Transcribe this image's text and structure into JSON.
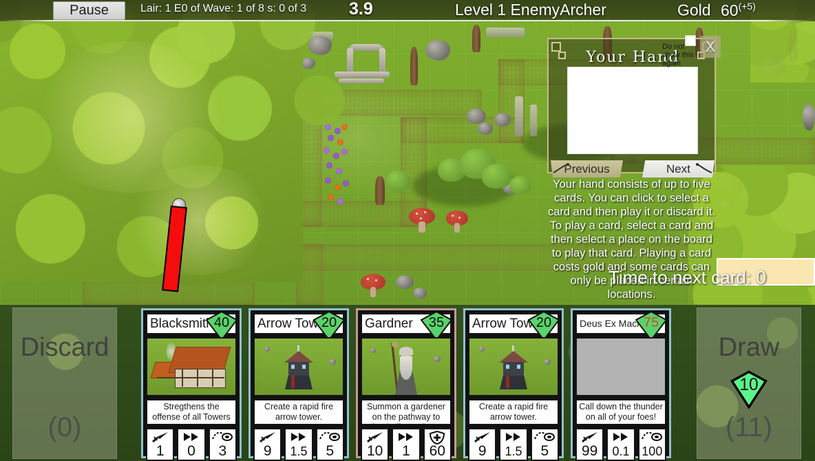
{
  "topbar": {
    "pause_label": "Pause",
    "wave_info": "Lair: 1 E0 of Wave: 1 of 8 s: 0 of 3",
    "timer": "3.9",
    "level_name": "Level 1 EnemyArcher",
    "gold_label": "Gold",
    "gold_value": "60",
    "gold_delta": "(+5)"
  },
  "dialog": {
    "title": "Your Hand",
    "do_not_show_label": "Do not show this again",
    "close_label": "X",
    "previous_label": "Previous",
    "next_label": "Next",
    "body": "Your hand consists of up to five cards. You can click to select a card and then play it or discard it. To play a card, select a card and then select a place on the board to play that card. Playing a card costs gold and some cards can only be placed in certain locations."
  },
  "next_card": {
    "label": "Time to next card: 0",
    "progress_percent": 100,
    "bar_color": "#fae6b0"
  },
  "discard_pile": {
    "title": "Discard",
    "count": "(0)"
  },
  "draw_pile": {
    "title": "Draw",
    "gem_value": "10",
    "count": "(11)"
  },
  "cards": [
    {
      "name": "Blacksmith",
      "cost": "40",
      "cost_color": "#141414",
      "border_color": "#8ec2cd",
      "description": "Stregthens the offense of all Towers",
      "art": "blacksmith",
      "stats": [
        {
          "icon": "sword-icon",
          "value": "1"
        },
        {
          "icon": "fast-forward-icon",
          "value": "0"
        },
        {
          "icon": "range-icon",
          "value": "3"
        }
      ]
    },
    {
      "name": "Arrow Tower",
      "cost": "20",
      "cost_color": "#141414",
      "border_color": "#8ec2cd",
      "description": "Create a rapid fire arrow tower.",
      "art": "tower",
      "stats": [
        {
          "icon": "sword-icon",
          "value": "9"
        },
        {
          "icon": "fast-forward-icon",
          "value": "1.5"
        },
        {
          "icon": "range-icon",
          "value": "5"
        }
      ]
    },
    {
      "name": "Gardner",
      "cost": "35",
      "cost_color": "#141414",
      "border_color": "#c49a93",
      "description": "Summon a gardener on the pathway to fend off your foes.",
      "art": "wizard",
      "stats": [
        {
          "icon": "sword-icon",
          "value": "10"
        },
        {
          "icon": "fast-forward-icon",
          "value": "1"
        },
        {
          "icon": "shield-health-icon",
          "value": "60"
        }
      ]
    },
    {
      "name": "Arrow Tower",
      "cost": "20",
      "cost_color": "#141414",
      "border_color": "#8ec2cd",
      "description": "Create a rapid fire arrow tower.",
      "art": "tower",
      "stats": [
        {
          "icon": "sword-icon",
          "value": "9"
        },
        {
          "icon": "fast-forward-icon",
          "value": "1.5"
        },
        {
          "icon": "range-icon",
          "value": "5"
        }
      ]
    },
    {
      "name": "Deus Ex Machina",
      "cost": "75",
      "cost_color": "#d14a2a",
      "border_color": "#8ec2cd",
      "description": "Call down the thunder on all of your foes!",
      "art": "none",
      "stats": [
        {
          "icon": "sword-icon",
          "value": "99"
        },
        {
          "icon": "fast-forward-icon",
          "value": "0.1"
        },
        {
          "icon": "range-icon",
          "value": "100"
        }
      ]
    }
  ],
  "map": {
    "enemy_health_color": "#f50d0d",
    "grass_color": "#76a62c",
    "path_color": "#d6b386"
  }
}
